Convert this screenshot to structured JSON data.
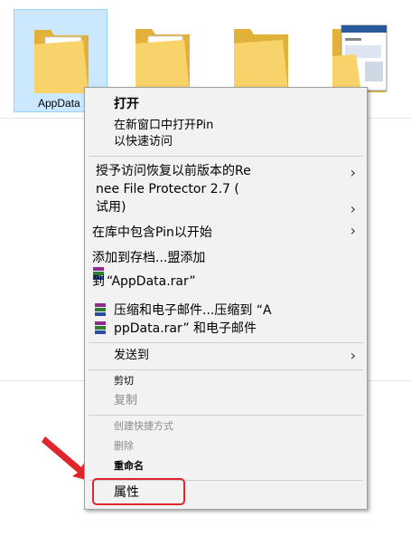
{
  "desktop": {
    "folders": [
      {
        "label": "AppData",
        "selected": true
      },
      {
        "label": "",
        "selected": false
      },
      {
        "label": "",
        "selected": false
      },
      {
        "label": "",
        "selected": false
      }
    ]
  },
  "context_menu": {
    "open": "打开",
    "open_new_window_line1": "在新窗口中打开Pin",
    "open_new_window_line2": "以快速访问",
    "grant_access_line1": "授予访问恢复以前版本的Re",
    "grant_access_line2": "nee File Protector 2.7 (",
    "grant_access_line3": "试用)",
    "include_in_library": "在库中包含Pin以开始",
    "add_to_archive": "添加到存档...盟添加",
    "add_to_rar_prefix": "到",
    "add_to_rar": "“AppData.rar”",
    "compress_email_line1": "压缩和电子邮件...压缩到 “A",
    "compress_email_line2": "ppData.rar” 和电子邮件",
    "send_to": "发送到",
    "cut": "剪切",
    "copy": "复制",
    "create_shortcut": "创建快捷方式",
    "delete": "删除",
    "rename": "重命名",
    "properties": "属性"
  },
  "icons": {
    "submenu": "chevron-right-icon",
    "archive": "winrar-icon",
    "callout": "red-arrow-icon"
  },
  "colors": {
    "highlight": "#e0262b",
    "selection_bg": "#cce8ff",
    "menu_bg": "#f2f2f2",
    "disabled_text": "#8a8a8a"
  }
}
